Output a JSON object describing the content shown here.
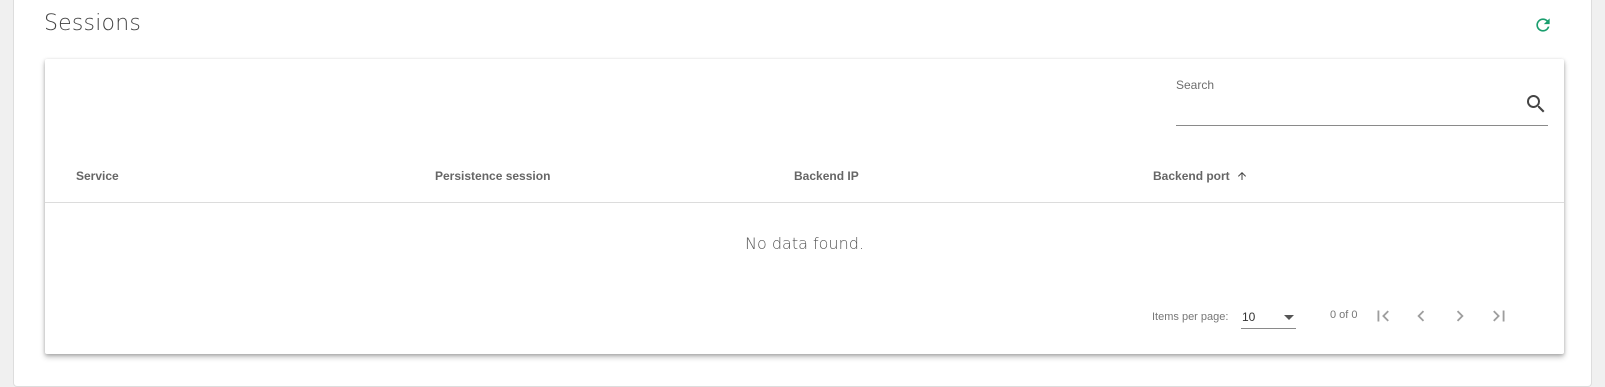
{
  "page": {
    "title": "Sessions"
  },
  "toolbar": {
    "refresh_icon": "refresh-icon",
    "accent": "#1a9e6e"
  },
  "search": {
    "label": "Search",
    "placeholder": "",
    "value": "",
    "icon": "search-icon"
  },
  "table": {
    "columns": [
      {
        "label": "Service"
      },
      {
        "label": "Persistence session"
      },
      {
        "label": "Backend IP"
      },
      {
        "label": "Backend port",
        "sort": "ascending"
      }
    ],
    "rows": [],
    "empty_text": "No data found."
  },
  "pagination": {
    "items_per_page_label": "Items per page:",
    "items_per_page": "10",
    "range": "0 of 0"
  }
}
